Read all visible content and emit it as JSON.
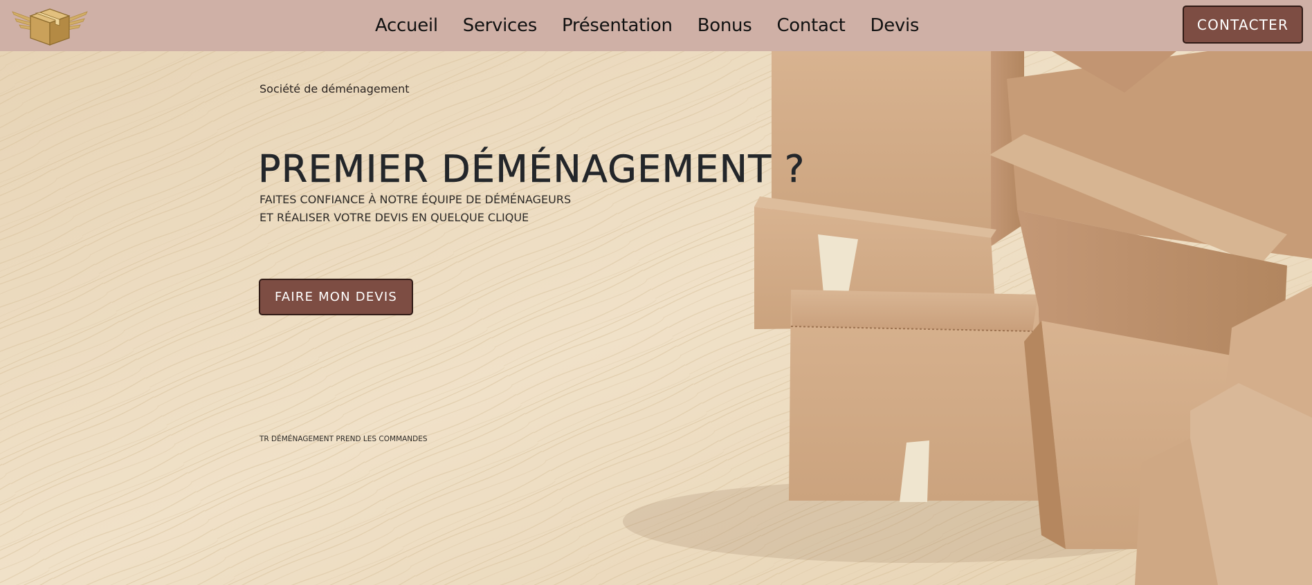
{
  "navbar": {
    "logo_icon": "winged-box-icon",
    "links": [
      {
        "label": "Accueil"
      },
      {
        "label": "Services"
      },
      {
        "label": "Présentation"
      },
      {
        "label": "Bonus"
      },
      {
        "label": "Contact"
      },
      {
        "label": "Devis"
      }
    ],
    "contact_label": "CONTACTER"
  },
  "hero": {
    "eyebrow": "Société de déménagement",
    "title": "PREMIER DÉMÉNAGEMENT ?",
    "line1": "FAITES CONFIANCE À NOTRE ÉQUIPE DE DÉMÉNAGEURS",
    "line2": "ET RÉALISER VOTRE DEVIS EN QUELQUE CLIQUE",
    "cta_label": "FAIRE MON DEVIS",
    "footnote": "TR DÉMÉNAGEMENT PREND LES COMMANDES",
    "background": "wooden-floor-with-cardboard-boxes"
  },
  "colors": {
    "navbar_bg": "#cfb0a6",
    "button_bg": "#7d4d43",
    "button_border": "#2f1a15",
    "text_dark": "#23262a"
  }
}
